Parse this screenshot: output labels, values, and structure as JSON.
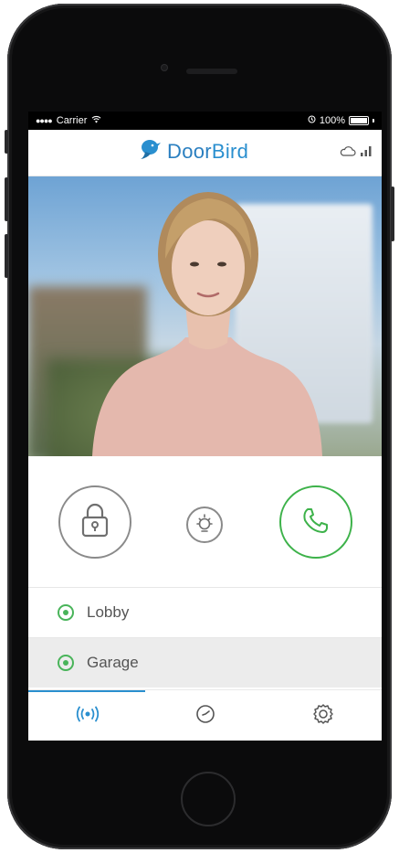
{
  "status_bar": {
    "signal_dots": "●●●●",
    "carrier": "Carrier",
    "battery_percent": "100%",
    "icons": [
      "wifi-icon",
      "alarm-icon",
      "battery-icon"
    ]
  },
  "app_bar": {
    "brand_door": "Door",
    "brand_bird": "Bird",
    "icons": [
      "bird-logo-icon",
      "cloud-icon",
      "signal-bars-icon"
    ]
  },
  "controls": {
    "icons": [
      "lock-icon",
      "light-icon",
      "phone-icon"
    ]
  },
  "doors": [
    {
      "label": "Lobby",
      "selected": false
    },
    {
      "label": "Garage",
      "selected": true
    }
  ],
  "tabs": [
    {
      "icon": "live-broadcast-icon",
      "active": true
    },
    {
      "icon": "history-clock-icon",
      "active": false
    },
    {
      "icon": "settings-gear-icon",
      "active": false
    }
  ],
  "colors": {
    "brand_blue": "#2a8fcf",
    "call_green": "#3db24a",
    "radio_green": "#49b45a",
    "icon_gray": "#8a8a8a"
  }
}
